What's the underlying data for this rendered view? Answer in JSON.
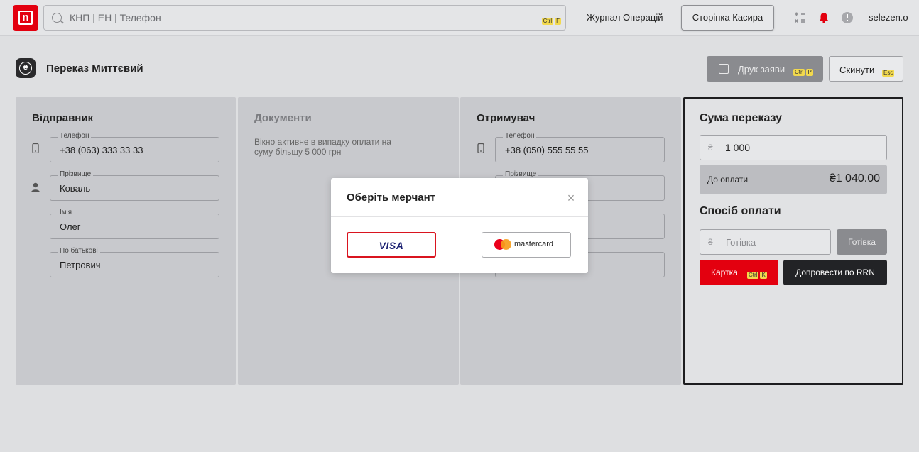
{
  "topbar": {
    "search_placeholder": "КНП | ЕН | Телефон",
    "search_hint": [
      "Ctrl",
      "F"
    ],
    "journal_link": "Журнал Операцій",
    "cashier_button": "Сторінка Касира",
    "user": "selezen.o",
    "icons": [
      "calculator-icon",
      "bell-icon",
      "alert-icon"
    ],
    "brand_color": "#e3000f"
  },
  "page": {
    "title": "Переказ Миттєвий",
    "print_button": "Друк заяви",
    "print_hint": [
      "Ctrl",
      "P"
    ],
    "reset_button": "Скинути",
    "reset_hint": "Esc"
  },
  "sender": {
    "title": "Відправник",
    "phone": {
      "label": "Телефон",
      "value": "+38 (063) 333 33 33"
    },
    "surname": {
      "label": "Прізвище",
      "value": "Коваль"
    },
    "name": {
      "label": "Ім'я",
      "value": "Олег"
    },
    "patronymic": {
      "label": "По батькові",
      "value": "Петрович"
    }
  },
  "documents": {
    "title": "Документи",
    "note": "Вікно активне в випадку оплати на суму більшу 5 000 грн"
  },
  "recipient": {
    "title": "Отримувач",
    "phone": {
      "label": "Телефон",
      "value": "+38 (050) 555 55 55"
    },
    "surname": {
      "label": "Прізвище",
      "value": ""
    }
  },
  "sum": {
    "title": "Сума переказу",
    "currency": "₴",
    "amount": "1 000",
    "to_pay_label": "До оплати",
    "to_pay_value": "₴1 040.00",
    "method_title": "Спосіб оплати",
    "cash_placeholder": "Готівка",
    "cash_button": "Готівка",
    "card_button": "Картка",
    "card_hint": [
      "Ctrl",
      "K"
    ],
    "rrn_button": "Допровести по RRN"
  },
  "modal": {
    "title": "Оберіть мерчант",
    "close": "×",
    "visa": "VISA",
    "mastercard": "mastercard"
  }
}
